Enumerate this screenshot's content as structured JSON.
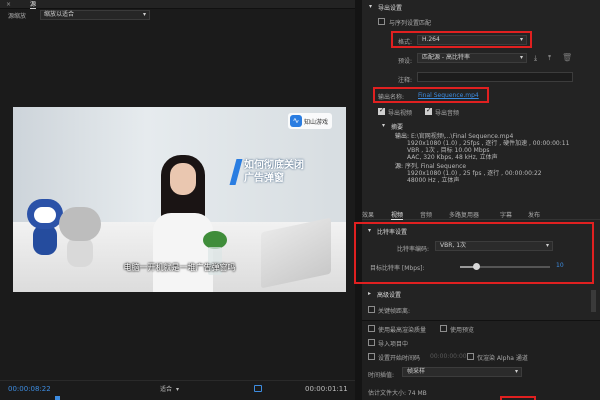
{
  "source_panel": {
    "tabs": [
      "×",
      "源"
    ],
    "scale_label": "源缩放",
    "scale_value": "缩放以适合"
  },
  "preview": {
    "logo_text": "知山游戏",
    "overlay_title_line1": "如何彻底关闭",
    "overlay_title_line2": "广告弹窗",
    "subtitle": "电脑一开机就是一堆广告弹窗吗"
  },
  "timeline": {
    "timecode_in": "00:00:08:22",
    "fit_label": "适合",
    "timecode_out": "00:00:01:11"
  },
  "export": {
    "section_title": "导出设置",
    "match_sequence": "与序列设置匹配",
    "format_label": "格式:",
    "format_value": "H.264",
    "preset_label": "预设:",
    "preset_value": "匹配源 - 高比特率",
    "comment_label": "注释:",
    "output_name_label": "输出名称:",
    "output_name_value": "Final Sequence.mp4",
    "export_video": "导出视频",
    "export_audio": "导出音频",
    "summary_title": "摘要",
    "output_key": "输出:",
    "output_line1": "E:\\官网视频\\...\\Final Sequence.mp4",
    "output_line2": "1920x1080 (1.0) , 25fps , 逐行 , 硬件加速 , 00:00:00:11",
    "output_line3": "VBR , 1次 , 目标 10.00 Mbps",
    "output_line4": "AAC, 320 Kbps, 48 kHz, 立体声",
    "source_key": "源:",
    "source_line1": "序列, Final Sequence",
    "source_line2": "1920x1080 (1.0) , 25 fps , 逐行 , 00:00:00:22",
    "source_line3": "48000 Hz , 立体声"
  },
  "tabs": [
    "效果",
    "视频",
    "音频",
    "多路复用器",
    "字幕",
    "发布"
  ],
  "active_tab_index": 1,
  "bitrate": {
    "section_title": "比特率设置",
    "encoding_label": "比特率编码:",
    "encoding_value": "VBR, 1次",
    "target_label": "目标比特率 [Mbps]:",
    "target_value": "10",
    "target_fraction": 0.18
  },
  "advanced": {
    "section_title": "高级设置",
    "keyframe_distance": "关键帧距离:"
  },
  "bottom": {
    "max_render_quality": "使用最高渲染质量",
    "use_previews": "使用预览",
    "import_to_project": "导入项目中",
    "set_start_timecode": "设置开始时间码",
    "start_timecode_value": "00:00:00:00",
    "render_alpha_only": "仅渲染 Alpha 通道",
    "time_interpolation_label": "时间插值:",
    "time_interpolation_value": "帧采样",
    "estimated_size": "估计文件大小: 74 MB"
  },
  "colors": {
    "accent_blue": "#3d8ce0",
    "highlight_red": "#e02020"
  }
}
